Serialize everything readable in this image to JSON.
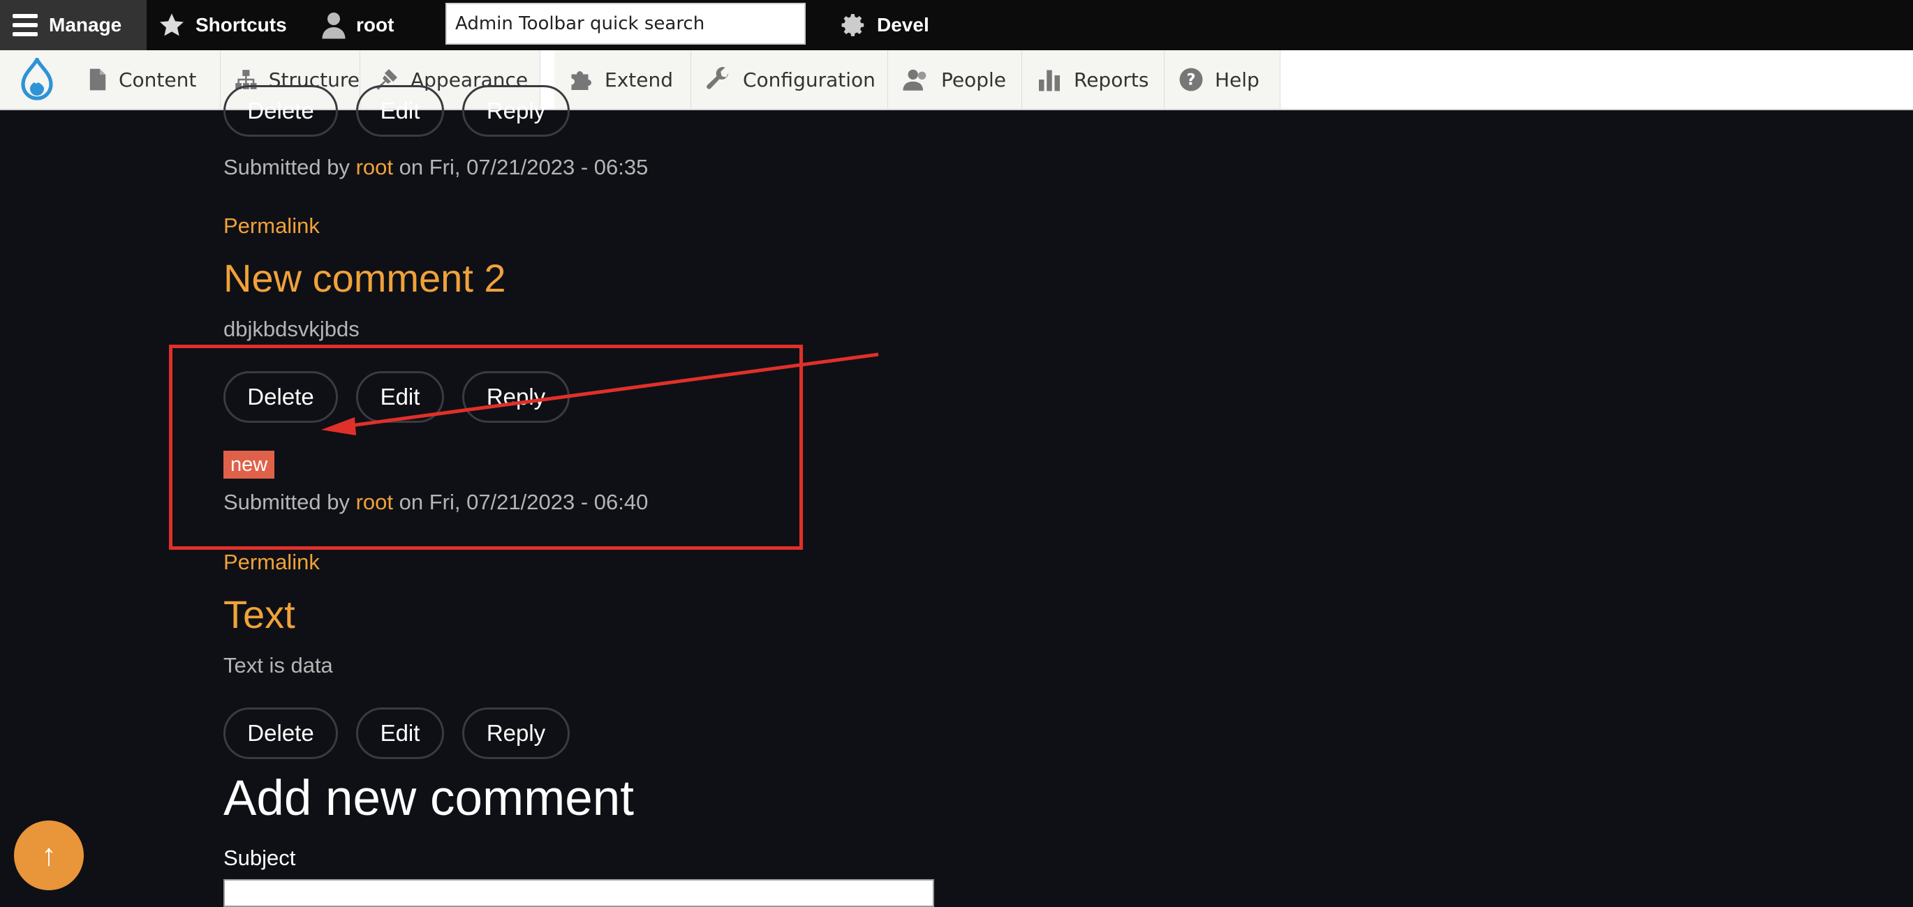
{
  "toolbar": {
    "manage_label": "Manage",
    "shortcuts_label": "Shortcuts",
    "user_label": "root",
    "search_placeholder": "Admin Toolbar quick search",
    "devel_label": "Devel"
  },
  "tray": {
    "items": [
      {
        "label": "Content",
        "icon": "document-icon"
      },
      {
        "label": "Structure",
        "icon": "sitemap-icon"
      },
      {
        "label": "Appearance",
        "icon": "paintbrush-icon"
      },
      {
        "label": "Extend",
        "icon": "puzzle-icon"
      },
      {
        "label": "Configuration",
        "icon": "wrench-icon"
      },
      {
        "label": "People",
        "icon": "people-icon"
      },
      {
        "label": "Reports",
        "icon": "bar-chart-icon"
      },
      {
        "label": "Help",
        "icon": "question-icon"
      }
    ]
  },
  "comments": [
    {
      "actions": {
        "delete": "Delete",
        "edit": "Edit",
        "reply": "Reply"
      },
      "submitted_prefix": "Submitted by",
      "author": "root",
      "date_text": "on Fri, 07/21/2023 - 06:35"
    },
    {
      "permalink": "Permalink",
      "title": "New comment 2",
      "body": "dbjkbdsvkjbds",
      "actions": {
        "delete": "Delete",
        "edit": "Edit",
        "reply": "Reply"
      },
      "badge": "new",
      "submitted_prefix": "Submitted by",
      "author": "root",
      "date_text": "on Fri, 07/21/2023 - 06:40"
    },
    {
      "permalink": "Permalink",
      "title": "Text",
      "body": "Text is data",
      "actions": {
        "delete": "Delete",
        "edit": "Edit",
        "reply": "Reply"
      }
    }
  ],
  "add_comment": {
    "title": "Add new comment",
    "subject_label": "Subject"
  },
  "back_to_top": {
    "icon": "arrow-up-icon",
    "glyph": "↑"
  },
  "colors": {
    "background": "#0f1015",
    "accent": "#f0a23a",
    "badge": "#e06149",
    "annotation": "#e0302a",
    "back_to_top": "#e9953a"
  }
}
